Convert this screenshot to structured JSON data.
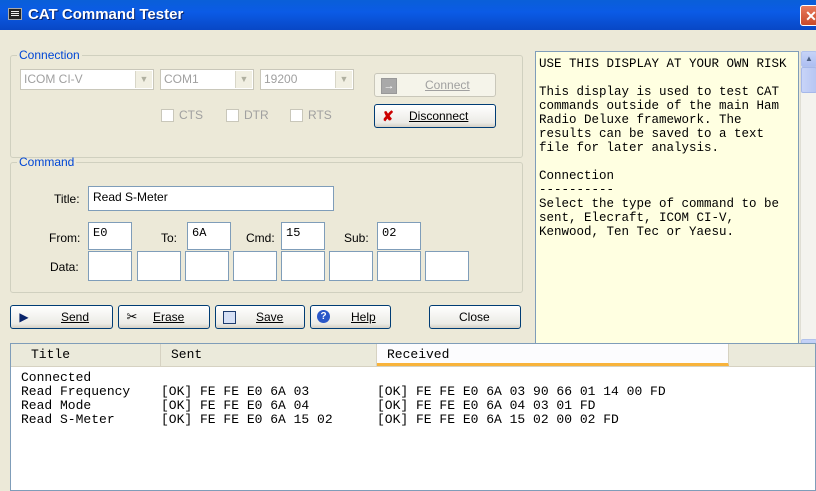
{
  "window": {
    "title": "CAT Command Tester",
    "close_glyph": "✕"
  },
  "connection": {
    "legend": "Connection",
    "radio": "ICOM CI-V",
    "port": "COM1",
    "baud": "19200",
    "connect_label": "Connect",
    "disconnect_label": "Disconnect",
    "cts": "CTS",
    "dtr": "DTR",
    "rts": "RTS"
  },
  "command": {
    "legend": "Command",
    "title_label": "Title:",
    "title_value": "Read S-Meter",
    "from_label": "From:",
    "from_value": "E0",
    "to_label": "To:",
    "to_value": "6A",
    "cmd_label": "Cmd:",
    "cmd_value": "15",
    "sub_label": "Sub:",
    "sub_value": "02",
    "data_label": "Data:",
    "data_values": [
      "",
      "",
      "",
      "",
      "",
      "",
      "",
      ""
    ]
  },
  "buttons": {
    "send": "Send",
    "erase": "Erase",
    "save": "Save",
    "help": "Help",
    "close": "Close"
  },
  "help_text": "USE THIS DISPLAY AT YOUR OWN RISK\n\nThis display is used to test CAT commands outside of the main Ham Radio Deluxe framework. The results can be saved to a text file for later analysis.\n\nConnection\n----------\nSelect the type of command to be sent, Elecraft, ICOM CI-V, Kenwood, Ten Tec or Yaesu.",
  "log": {
    "columns": [
      "Title",
      "Sent",
      "Received"
    ],
    "rows": [
      {
        "title": "Connected",
        "sent": "",
        "received": ""
      },
      {
        "title": "Read Frequency",
        "sent": "[OK] FE FE E0 6A 03",
        "received": "[OK] FE FE E0 6A 03 90 66 01 14 00 FD"
      },
      {
        "title": "Read Mode",
        "sent": "[OK] FE FE E0 6A 04",
        "received": "[OK] FE FE E0 6A 04 03 01 FD"
      },
      {
        "title": "Read S-Meter",
        "sent": "[OK] FE FE E0 6A 15 02",
        "received": "[OK] FE FE E0 6A 15 02 00 02 FD"
      }
    ]
  }
}
